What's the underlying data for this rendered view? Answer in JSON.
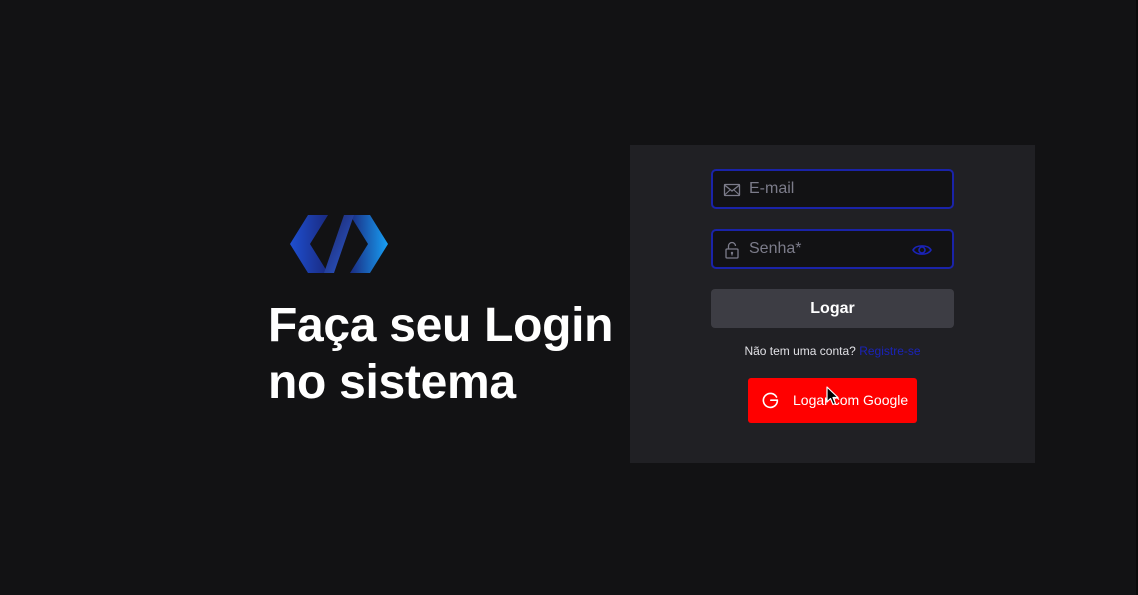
{
  "hero": {
    "logo_icon": "code-brackets-logo-icon",
    "title_line1": "Faça seu Login",
    "title_line2": "no sistema"
  },
  "form": {
    "email": {
      "placeholder": "E-mail",
      "value": "",
      "icon": "envelope-icon"
    },
    "password": {
      "placeholder": "Senha*",
      "value": "",
      "icon": "lock-icon",
      "toggle_icon": "eye-icon"
    },
    "login_label": "Logar",
    "signup_prompt": "Não tem uma conta?",
    "signup_link": "Registre-se",
    "google_label": "Logar com Google",
    "google_icon": "google-g-icon"
  },
  "colors": {
    "background": "#121214",
    "card": "#202024",
    "field_border": "#1a23a8",
    "login_button": "#3d3d44",
    "google_button": "#ff0000",
    "link": "#1a23b8",
    "logo_gradient_start": "#1e3fb8",
    "logo_gradient_end": "#1a9bf0"
  }
}
